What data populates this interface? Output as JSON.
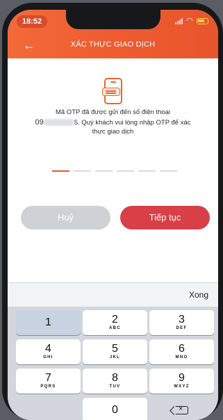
{
  "status_bar": {
    "time": "18:52"
  },
  "header": {
    "back_icon": "←",
    "title": "XÁC THỰC GIAO DỊCH"
  },
  "message": {
    "line1": "Mã OTP đã được gửi đến số điện thoại",
    "phone_prefix": "09",
    "line2_rest": "5. Quý khách vui lòng nhập OTP để xác",
    "line3": "thực giao dịch"
  },
  "otp": {
    "length": 6,
    "filled": 0
  },
  "buttons": {
    "cancel": "Huỷ",
    "next": "Tiếp tục"
  },
  "keyboard": {
    "done": "Xong",
    "keys": [
      {
        "digit": "1",
        "letters": ""
      },
      {
        "digit": "2",
        "letters": "ABC"
      },
      {
        "digit": "3",
        "letters": "DEF"
      },
      {
        "digit": "4",
        "letters": "GHI"
      },
      {
        "digit": "5",
        "letters": "JKL"
      },
      {
        "digit": "6",
        "letters": "MNO"
      },
      {
        "digit": "7",
        "letters": "PQRS"
      },
      {
        "digit": "8",
        "letters": "TUV"
      },
      {
        "digit": "9",
        "letters": "WXYZ"
      },
      {
        "digit": "0",
        "letters": ""
      }
    ]
  },
  "colors": {
    "accent": "#e8552d",
    "next_button": "#d93f47",
    "cancel_button": "#d0d1d7"
  }
}
